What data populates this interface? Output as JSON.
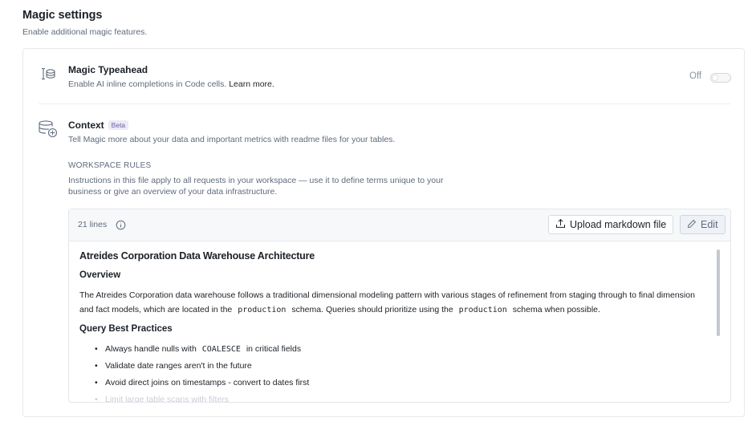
{
  "header": {
    "title": "Magic settings",
    "subtitle": "Enable additional magic features."
  },
  "typeahead": {
    "icon": "text-cursor-database-icon",
    "title": "Magic Typeahead",
    "description": "Enable AI inline completions in Code cells.",
    "link": "Learn more.",
    "toggle_label": "Off",
    "toggle_on": false
  },
  "context": {
    "icon": "database-stack-icon",
    "title": "Context",
    "badge": "Beta",
    "description": "Tell Magic more about your data and important metrics with readme files for your tables.",
    "workspace_rules": {
      "label": "WORKSPACE RULES",
      "description": "Instructions in this file apply to all requests in your workspace — use it to define terms unique to your business or give an overview of your data infrastructure."
    },
    "editor": {
      "line_count": "21 lines",
      "upload_label": "Upload markdown file",
      "edit_label": "Edit",
      "doc": {
        "h1": "Atreides Corporation Data Warehouse Architecture",
        "h2_overview": "Overview",
        "p_part1": "The Atreides Corporation data warehouse follows a traditional dimensional modeling pattern with various stages of refinement from staging through to final dimension and fact models, which are located in the",
        "p_code1": "production",
        "p_part2": "schema. Queries should prioritize using the",
        "p_code2": "production",
        "p_part3": "schema when possible.",
        "h2_practices": "Query Best Practices",
        "item1_pre": "Always handle nulls with",
        "item1_code": "COALESCE",
        "item1_post": "in critical fields",
        "item2": "Validate date ranges aren't in the future",
        "item3": "Avoid direct joins on timestamps - convert to dates first",
        "item4": "Limit large table scans with filters"
      }
    }
  }
}
